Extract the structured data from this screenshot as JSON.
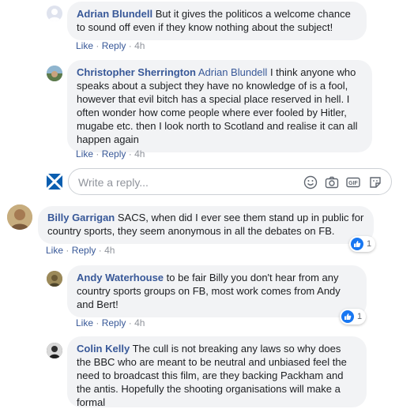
{
  "comments": [
    {
      "name": "Adrian Blundell",
      "mention": "",
      "text": "But it gives the politicos a welcome chance to sound off even if they know nothing about the subject!",
      "like": "Like",
      "reply": "Reply",
      "time": "4h"
    },
    {
      "name": "Christopher Sherrington",
      "mention": "Adrian Blundell",
      "text": "I think anyone who speaks about a subject they have no knowledge of is a fool, however that evil bitch has a special place reserved in hell. I often wonder how come people where ever fooled by Hitler, mugabe etc. then I look north to Scotland and realise it can all happen again",
      "like": "Like",
      "reply": "Reply",
      "time": "4h"
    },
    {
      "name": "Billy Garrigan",
      "mention": "",
      "text": "SACS, when did I ever see them stand up in public for country sports, they seem anonymous in all the debates on FB.",
      "like": "Like",
      "reply": "Reply",
      "time": "4h",
      "reaction_count": "1"
    },
    {
      "name": "Andy Waterhouse",
      "mention": "",
      "text": "to be fair Billy you don't hear from any country sports groups on FB, most work comes from Andy and Bert!",
      "like": "Like",
      "reply": "Reply",
      "time": "4h",
      "reaction_count": "1"
    },
    {
      "name": "Colin Kelly",
      "mention": "",
      "text": "The cull is not breaking any laws so why does the BBC who are meant to be neutral and unbiased feel the need to broadcast this film, are they backing Packham and the antis. Hopefully the shooting organisations will make a formal"
    }
  ],
  "reply_box": {
    "placeholder": "Write a reply...",
    "icons": [
      "smiley-icon",
      "camera-icon",
      "gif-icon",
      "sticker-icon"
    ]
  },
  "separator": "·",
  "colors": {
    "link": "#385898",
    "bubble": "#f2f3f5",
    "meta": "#90949c",
    "like_blue": "#1877f2"
  }
}
